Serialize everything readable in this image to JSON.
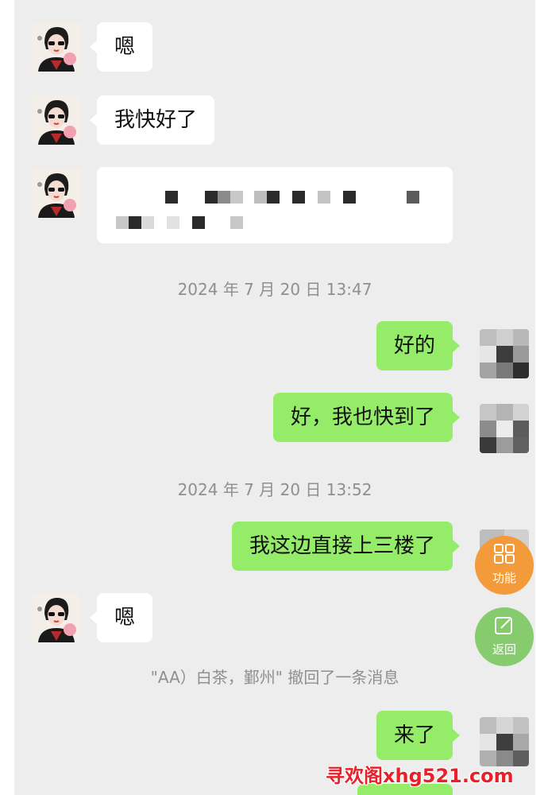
{
  "messages": {
    "m1_text": "嗯",
    "m2_text": "我快好了",
    "m4_text": "好的",
    "m5_text": "好，我也快到了",
    "m6_text": "我这边直接上三楼了",
    "m7_text": "嗯",
    "m9_text": "来了"
  },
  "timestamps": {
    "t1": "2024 年 7 月 20 日 13:47",
    "t2": "2024 年 7 月 20 日 13:52"
  },
  "system": {
    "recall_notice": "\"AA）白茶，鄞州\" 撤回了一条消息"
  },
  "floating": {
    "function_label": "功能",
    "back_label": "返回"
  },
  "watermark": "寻欢阁xhg521.com",
  "colors": {
    "chat_bg": "#ededed",
    "outgoing_bubble": "#95ec69",
    "incoming_bubble": "#ffffff",
    "fab_function": "#f39a3a",
    "fab_back": "#86cc6e",
    "watermark": "#e8202a"
  },
  "icons": {
    "function": "grid-icon",
    "back": "edit-square-icon"
  }
}
